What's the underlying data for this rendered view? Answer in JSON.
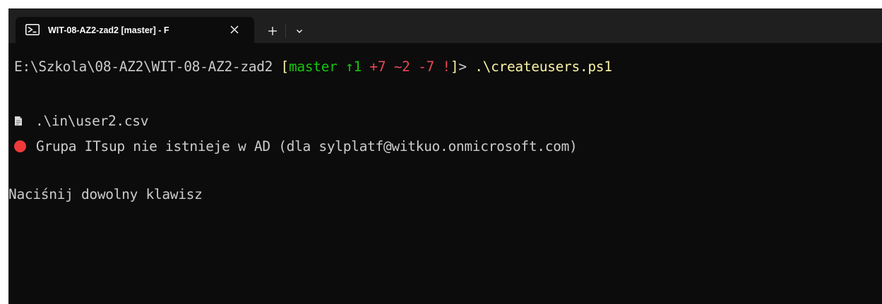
{
  "window": {
    "tab_title": "WIT-08-AZ2-zad2 [master] - F",
    "tab_icon": "powershell-icon",
    "close_icon": "close-icon",
    "new_tab_icon": "plus-icon",
    "dropdown_icon": "chevron-down-icon"
  },
  "terminal": {
    "prompt_path": "E:\\Szkola\\08-AZ2\\WIT-08-AZ2-zad2 ",
    "git_open": "[",
    "git_branch": "master ",
    "git_ahead": "↑1 ",
    "git_added": "+7 ",
    "git_modified": "~2 ",
    "git_deleted": "-7 ",
    "git_unstaged": "!",
    "git_close": "]",
    "prompt_end": "> ",
    "command": ".\\createusers.ps1",
    "file_line": ".\\in\\user2.csv",
    "file_icon": "file-icon",
    "error_icon": "red-circle-icon",
    "error_line": "Grupa ITsup nie istnieje w AD (dla sylplatf@witkuo.onmicrosoft.com)",
    "press_key_line": "Naciśnij dowolny klawisz"
  },
  "colors": {
    "background": "#0c0c0c",
    "tabbar": "#1f1f1f",
    "text": "#cccccc",
    "yellow": "#f9f1a5",
    "green": "#16c60c",
    "red": "#e74856",
    "error_dot": "#f03a3a"
  }
}
